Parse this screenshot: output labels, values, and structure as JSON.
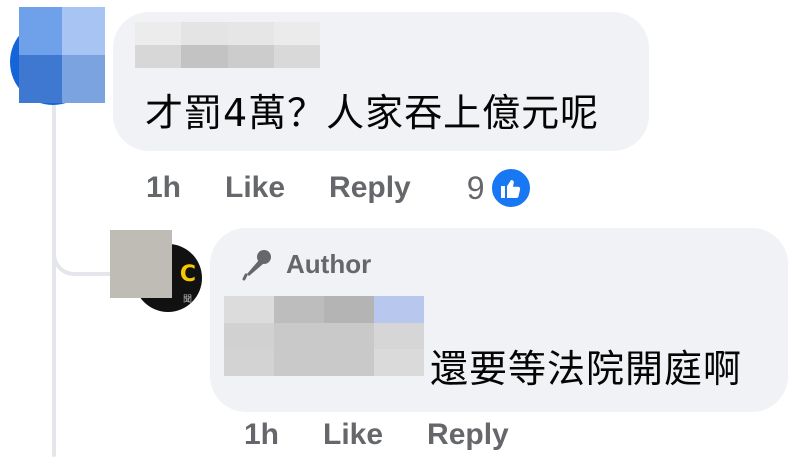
{
  "comment": {
    "text": "才罰4萬？人家吞上億元呢",
    "time": "1h",
    "like_label": "Like",
    "reply_label": "Reply",
    "reaction_count": "9",
    "reaction_icon": "thumbs-up-icon"
  },
  "reply": {
    "badge_label": "Author",
    "badge_icon": "microphone-icon",
    "text": "還要等法院開庭啊",
    "time": "1h",
    "like_label": "Like",
    "reply_label": "Reply"
  },
  "colors": {
    "bubble": "#f0f2f5",
    "secondary_text": "#65676b",
    "like_blue": "#1877f2",
    "thread_line": "#e4e6eb"
  }
}
